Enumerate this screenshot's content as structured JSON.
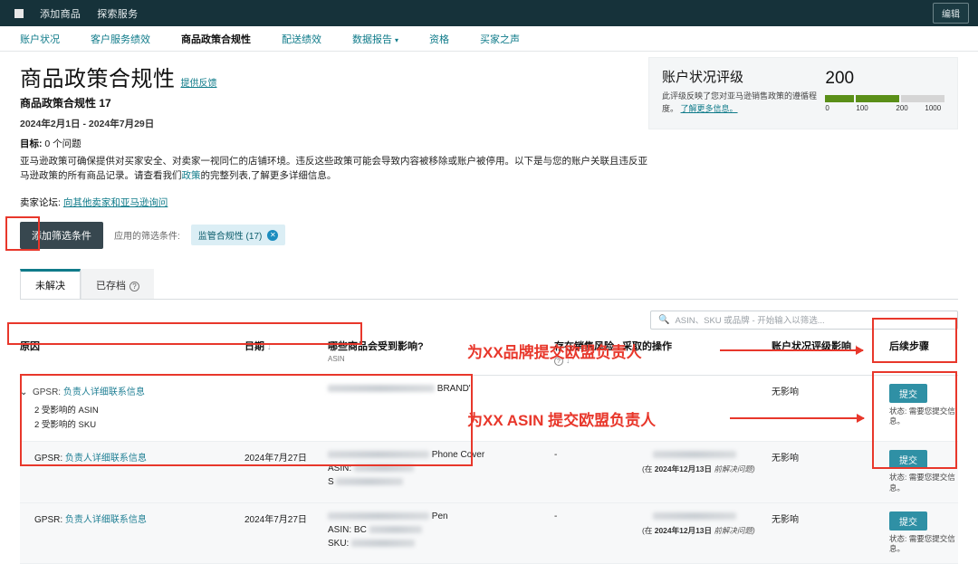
{
  "topbar": {
    "logo": "amazon-logo-icon",
    "links": [
      "添加商品",
      "探索服务"
    ],
    "edit_label": "编辑"
  },
  "subnav": {
    "items": [
      {
        "label": "账户状况",
        "active": false
      },
      {
        "label": "客户服务绩效",
        "active": false
      },
      {
        "label": "商品政策合规性",
        "active": true
      },
      {
        "label": "配送绩效",
        "active": false
      },
      {
        "label": "数据报告",
        "active": false,
        "caret": "▾"
      },
      {
        "label": "资格",
        "active": false
      },
      {
        "label": "买家之声",
        "active": false
      }
    ]
  },
  "header": {
    "title": "商品政策合规性",
    "feedback_link": "提供反馈",
    "subtitle": "商品政策合规性 17",
    "date_range": "2024年2月1日 - 2024年7月29日",
    "goal_label": "目标:",
    "goal_value": "0 个问题",
    "description_part1": "亚马逊政策可确保提供对买家安全、对卖家一视同仁的店铺环境。违反这些政策可能会导致内容被移除或账户被停用。以下是与您的账户关联且违反亚马逊政策的所有商品记录。请查看我们",
    "description_link": "政策",
    "description_part2": "的完整列表,了解更多详细信息。",
    "forum_label": "卖家论坛:",
    "forum_link": "向其他卖家和亚马逊询问"
  },
  "health_card": {
    "title": "账户状况评级",
    "description": "此评级反映了您对亚马逊销售政策的遵循程度。",
    "learn_more": "了解更多信息。",
    "score": "200",
    "scale": [
      "0",
      "100",
      "200",
      "1000"
    ],
    "bar_color": "#5a8f18"
  },
  "filters": {
    "add_button": "添加筛选条件",
    "applied_label": "应用的筛选条件:",
    "chips": [
      {
        "label": "监管合规性 (17)",
        "close": "✕"
      }
    ]
  },
  "tabs": [
    {
      "label": "未解决",
      "active": true
    },
    {
      "label": "已存档",
      "active": false,
      "help": "?"
    }
  ],
  "search": {
    "icon": "search-icon",
    "placeholder": "ASIN、SKU 或品牌 - 开始输入以筛选..."
  },
  "table": {
    "headers": [
      {
        "label": "原因",
        "sub": "",
        "sort": ""
      },
      {
        "label": "日期",
        "sub": "",
        "sort": "↓"
      },
      {
        "label": "哪些商品会受到影响?",
        "sub": "ASIN",
        "sort": ""
      },
      {
        "label": "存在销售风险",
        "sub": "",
        "sort": "↓",
        "help": "?"
      },
      {
        "label": "采取的操作",
        "sub": "",
        "sort": ""
      },
      {
        "label": "账户状况评级影响",
        "sub": "",
        "sort": "↓"
      },
      {
        "label": "后续步骤",
        "sub": "",
        "sort": ""
      }
    ],
    "rows": [
      {
        "expander": "⌄",
        "reason_key": "GPSR:",
        "reason_value": "负责人详细联系信息",
        "date": "",
        "product_suffix": "BRAND\"",
        "product_asin": "",
        "product_sku": "",
        "affected_asin": "2 受影响的 ASIN",
        "affected_sku": "2 受影响的 SKU",
        "sales_risk": "",
        "action_taken": "",
        "deadline": "",
        "health_impact": "无影响",
        "submit_label": "提交",
        "status_label": "状态:",
        "status_value": "需要您提交信息。"
      },
      {
        "expander": "",
        "reason_key": "GPSR:",
        "reason_value": "负责人详细联系信息",
        "date": "2024年7月27日",
        "product_suffix": "Phone Cover",
        "product_asin": "ASIN:",
        "product_sku": "S",
        "affected_asin": "",
        "affected_sku": "",
        "sales_risk": "-",
        "action_taken": "",
        "deadline_prefix": "(在",
        "deadline_date": "2024年12月13日",
        "deadline_suffix": "前解决问题)",
        "health_impact": "无影响",
        "submit_label": "提交",
        "status_label": "状态:",
        "status_value": "需要您提交信息。"
      },
      {
        "expander": "",
        "reason_key": "GPSR:",
        "reason_value": "负责人详细联系信息",
        "date": "2024年7月27日",
        "product_suffix": "Pen",
        "product_asin": "ASIN: BC",
        "product_sku": "SKU:",
        "affected_asin": "",
        "affected_sku": "",
        "sales_risk": "-",
        "action_taken": "",
        "deadline_prefix": "(在",
        "deadline_date": "2024年12月13日",
        "deadline_suffix": "前解决问题)",
        "health_impact": "无影响",
        "submit_label": "提交",
        "status_label": "状态:",
        "status_value": "需要您提交信息。"
      }
    ]
  },
  "annotations": {
    "color": "#e8372b",
    "note_brand": "为XX品牌提交欧盟负责人",
    "note_asin": "为XX ASIN 提交欧盟负责人"
  }
}
